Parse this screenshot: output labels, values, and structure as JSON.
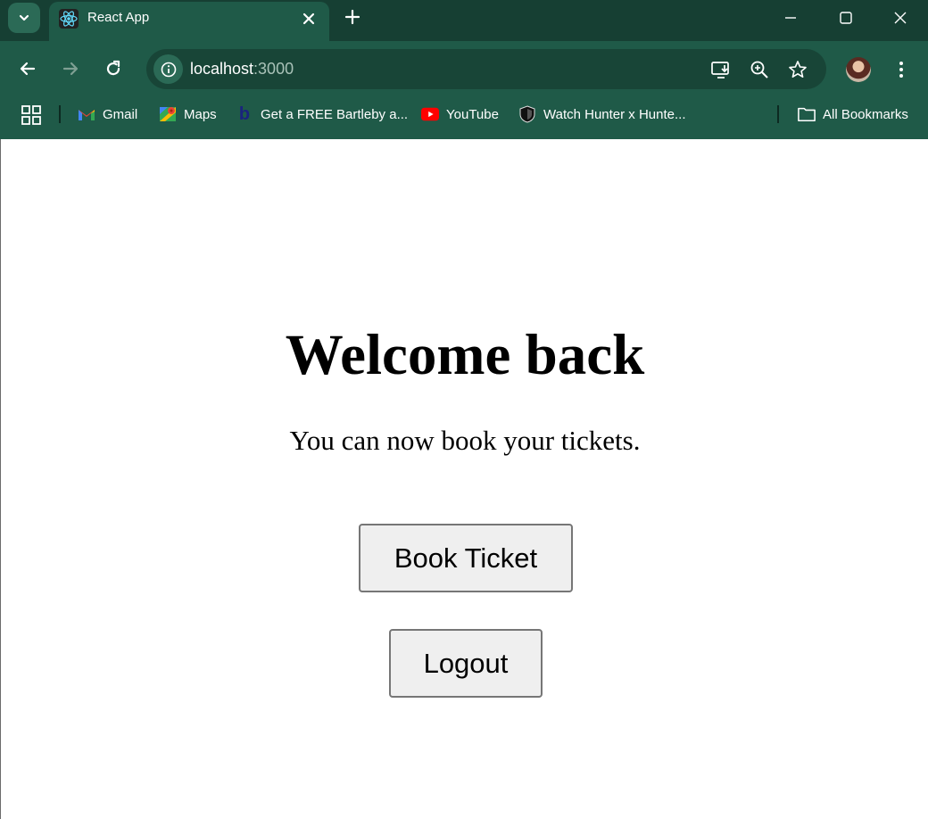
{
  "browser": {
    "tab": {
      "title": "React App"
    },
    "address_bar": {
      "host": "localhost",
      "port": ":3000"
    },
    "bookmarks": [
      {
        "label": "Gmail",
        "icon": "gmail-icon"
      },
      {
        "label": "Maps",
        "icon": "maps-icon"
      },
      {
        "label": "Get a FREE Bartleby a...",
        "icon": "bartleby-icon"
      },
      {
        "label": "YouTube",
        "icon": "youtube-icon"
      },
      {
        "label": "Watch Hunter x Hunte...",
        "icon": "shield-icon"
      }
    ],
    "all_bookmarks_label": "All Bookmarks",
    "colors": {
      "frame": "#163f33",
      "toolbar": "#1f5a48",
      "omnibox": "#184537"
    }
  },
  "page": {
    "heading": "Welcome back",
    "subtitle": "You can now book your tickets.",
    "book_button_label": "Book Ticket",
    "logout_button_label": "Logout"
  }
}
